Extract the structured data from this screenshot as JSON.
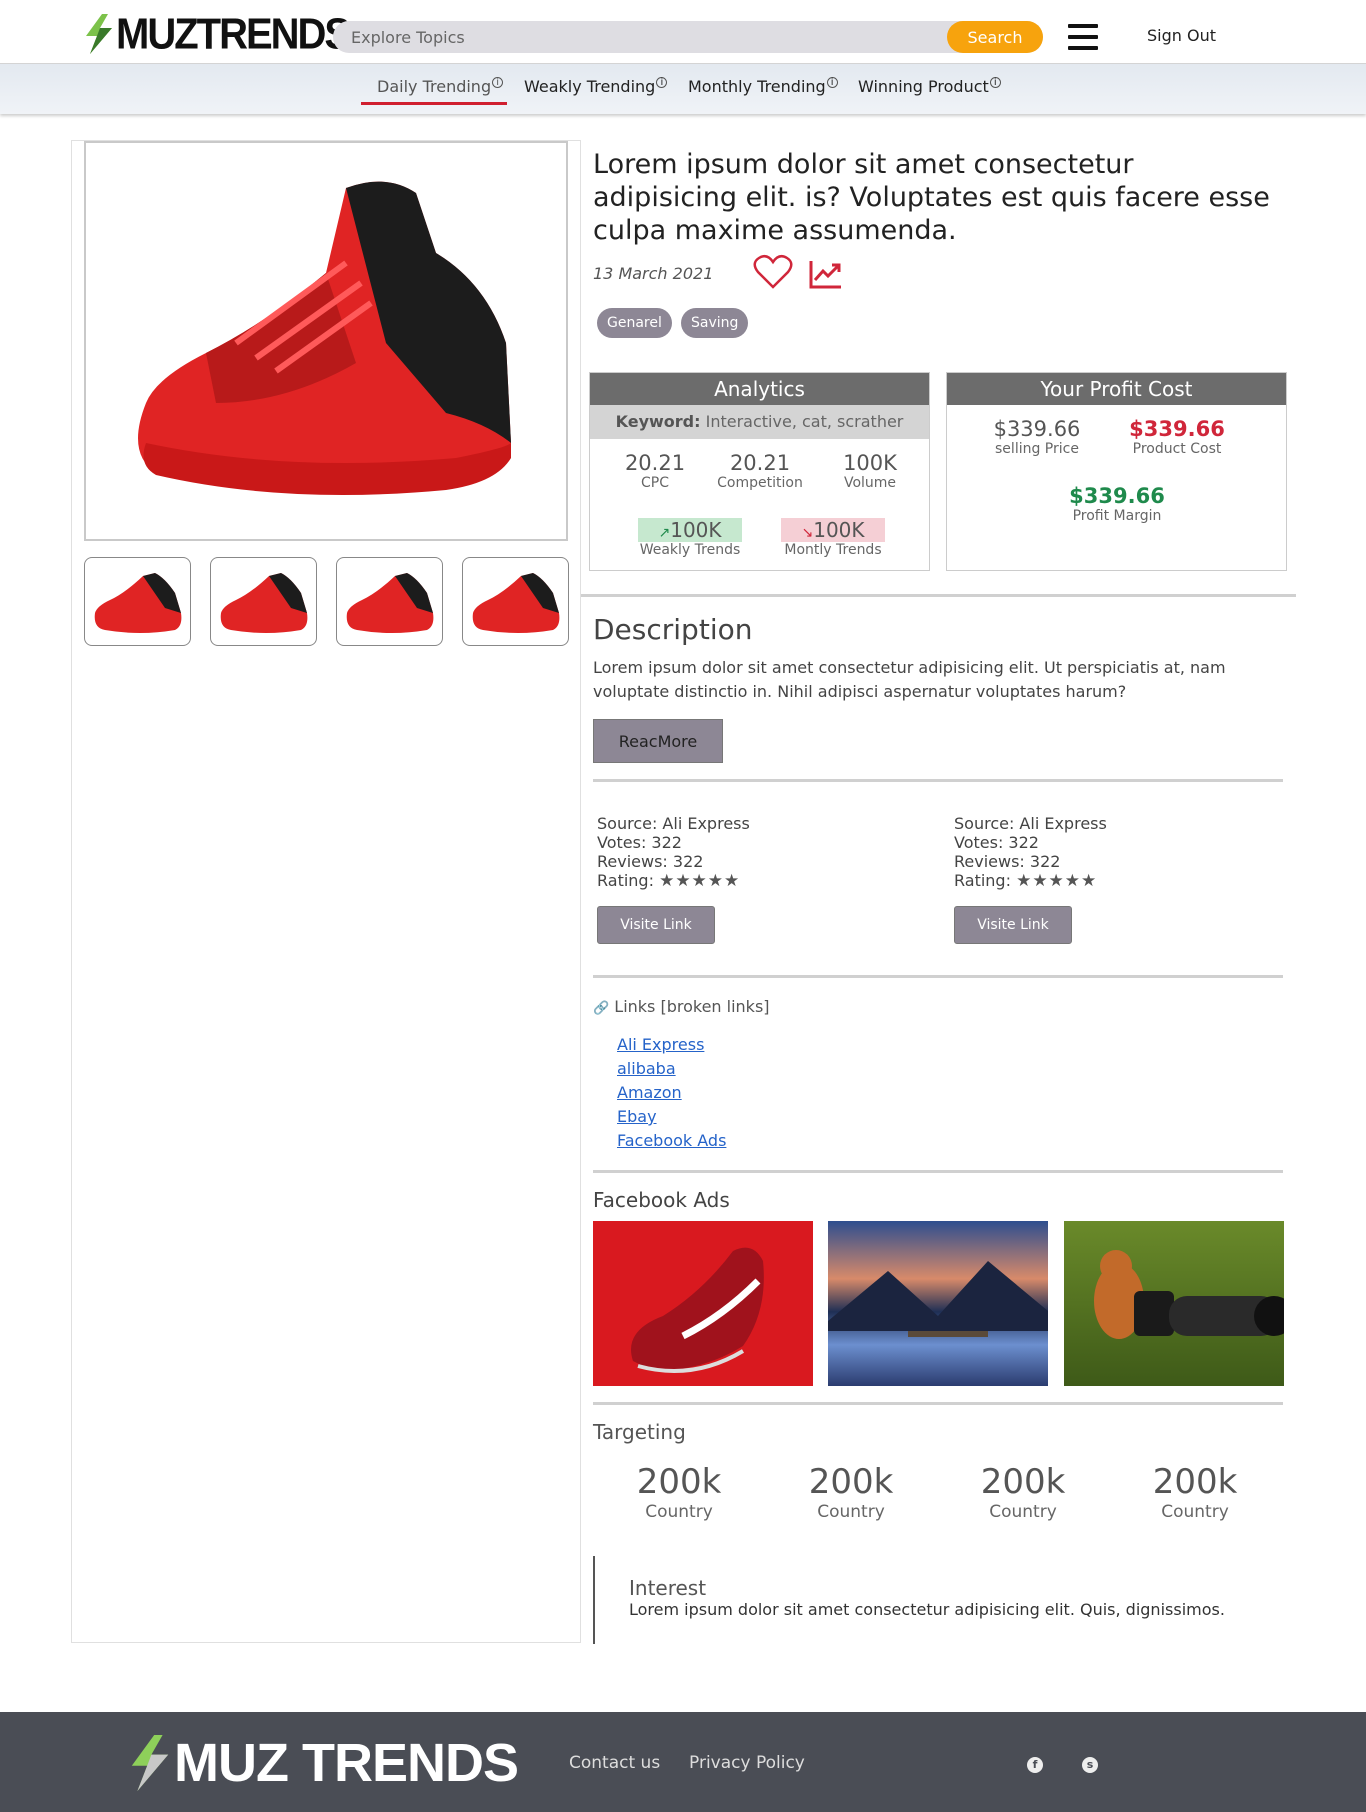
{
  "brand": {
    "logo_text": "MUZTRENDS",
    "footer_logo_text": "MUZ TRENDS"
  },
  "header": {
    "search_placeholder": "Explore Topics",
    "search_button": "Search",
    "signout": "Sign Out"
  },
  "subnav": {
    "tabs": [
      {
        "label": "Daily Trending",
        "info": "i"
      },
      {
        "label": "Weakly Trending",
        "info": "i"
      },
      {
        "label": "Monthly Trending",
        "info": "i"
      },
      {
        "label": "Winning Product",
        "info": "i"
      }
    ],
    "active_index": 0
  },
  "product": {
    "title": "Lorem ipsum dolor sit amet consectetur adipisicing elit. is? Voluptates est quis facere esse culpa maxime assumenda.",
    "date": "13 March 2021",
    "tags": [
      "Genarel",
      "Saving"
    ],
    "icons": [
      "heart-icon",
      "trending-up-icon"
    ]
  },
  "analytics": {
    "title": "Analytics",
    "keyword_label": "Keyword:",
    "keyword_value": "Interactive, cat, scrather",
    "cpc_value": "20.21",
    "cpc_label": "CPC",
    "competition_value": "20.21",
    "competition_label": "Competition",
    "volume_value": "100K",
    "volume_label": "Volume",
    "weekly_value": "100K",
    "weekly_label": "Weakly Trends",
    "monthly_value": "100K",
    "monthly_label": "Montly Trends",
    "weekly_color": "#c6e8cf",
    "monthly_color": "#f5cfd5"
  },
  "profit": {
    "title": "Your Profit Cost",
    "selling_price": "$339.66",
    "selling_label": "selling Price",
    "product_cost": "$339.66",
    "product_cost_label": "Product Cost",
    "margin": "$339.66",
    "margin_label": "Profit Margin",
    "cost_color": "#d0263a",
    "margin_color": "#1f8a4c"
  },
  "description": {
    "heading": "Description",
    "text": "Lorem ipsum dolor sit amet consectetur adipisicing elit. Ut perspiciatis at, nam voluptate distinctio in. Nihil adipisci aspernatur voluptates harum?",
    "button": "ReacMore"
  },
  "sources": [
    {
      "source": "Source: Ali Express",
      "votes": "Votes: 322",
      "reviews": "Reviews: 322",
      "rating_label": "Rating:",
      "stars": "★★★★★",
      "button": "Visite Link"
    },
    {
      "source": "Source: Ali Express",
      "votes": "Votes: 322",
      "reviews": "Reviews: 322",
      "rating_label": "Rating:",
      "stars": "★★★★★",
      "button": "Visite Link"
    }
  ],
  "links": {
    "heading": "Links [broken links]",
    "items": [
      "Ali Express",
      "alibaba",
      "Amazon",
      "Ebay",
      "Facebook Ads"
    ]
  },
  "facebook_ads": {
    "heading": "Facebook Ads"
  },
  "targeting": {
    "heading": "Targeting",
    "stats": [
      {
        "value": "200k",
        "label": "Country"
      },
      {
        "value": "200k",
        "label": "Country"
      },
      {
        "value": "200k",
        "label": "Country"
      },
      {
        "value": "200k",
        "label": "Country"
      }
    ]
  },
  "interest": {
    "heading": "Interest",
    "text": "Lorem ipsum dolor sit amet consectetur adipisicing elit. Quis, dignissimos."
  },
  "footer": {
    "contact": "Contact us",
    "privacy": "Privacy Policy",
    "social": [
      "facebook-icon",
      "skype-icon"
    ]
  }
}
